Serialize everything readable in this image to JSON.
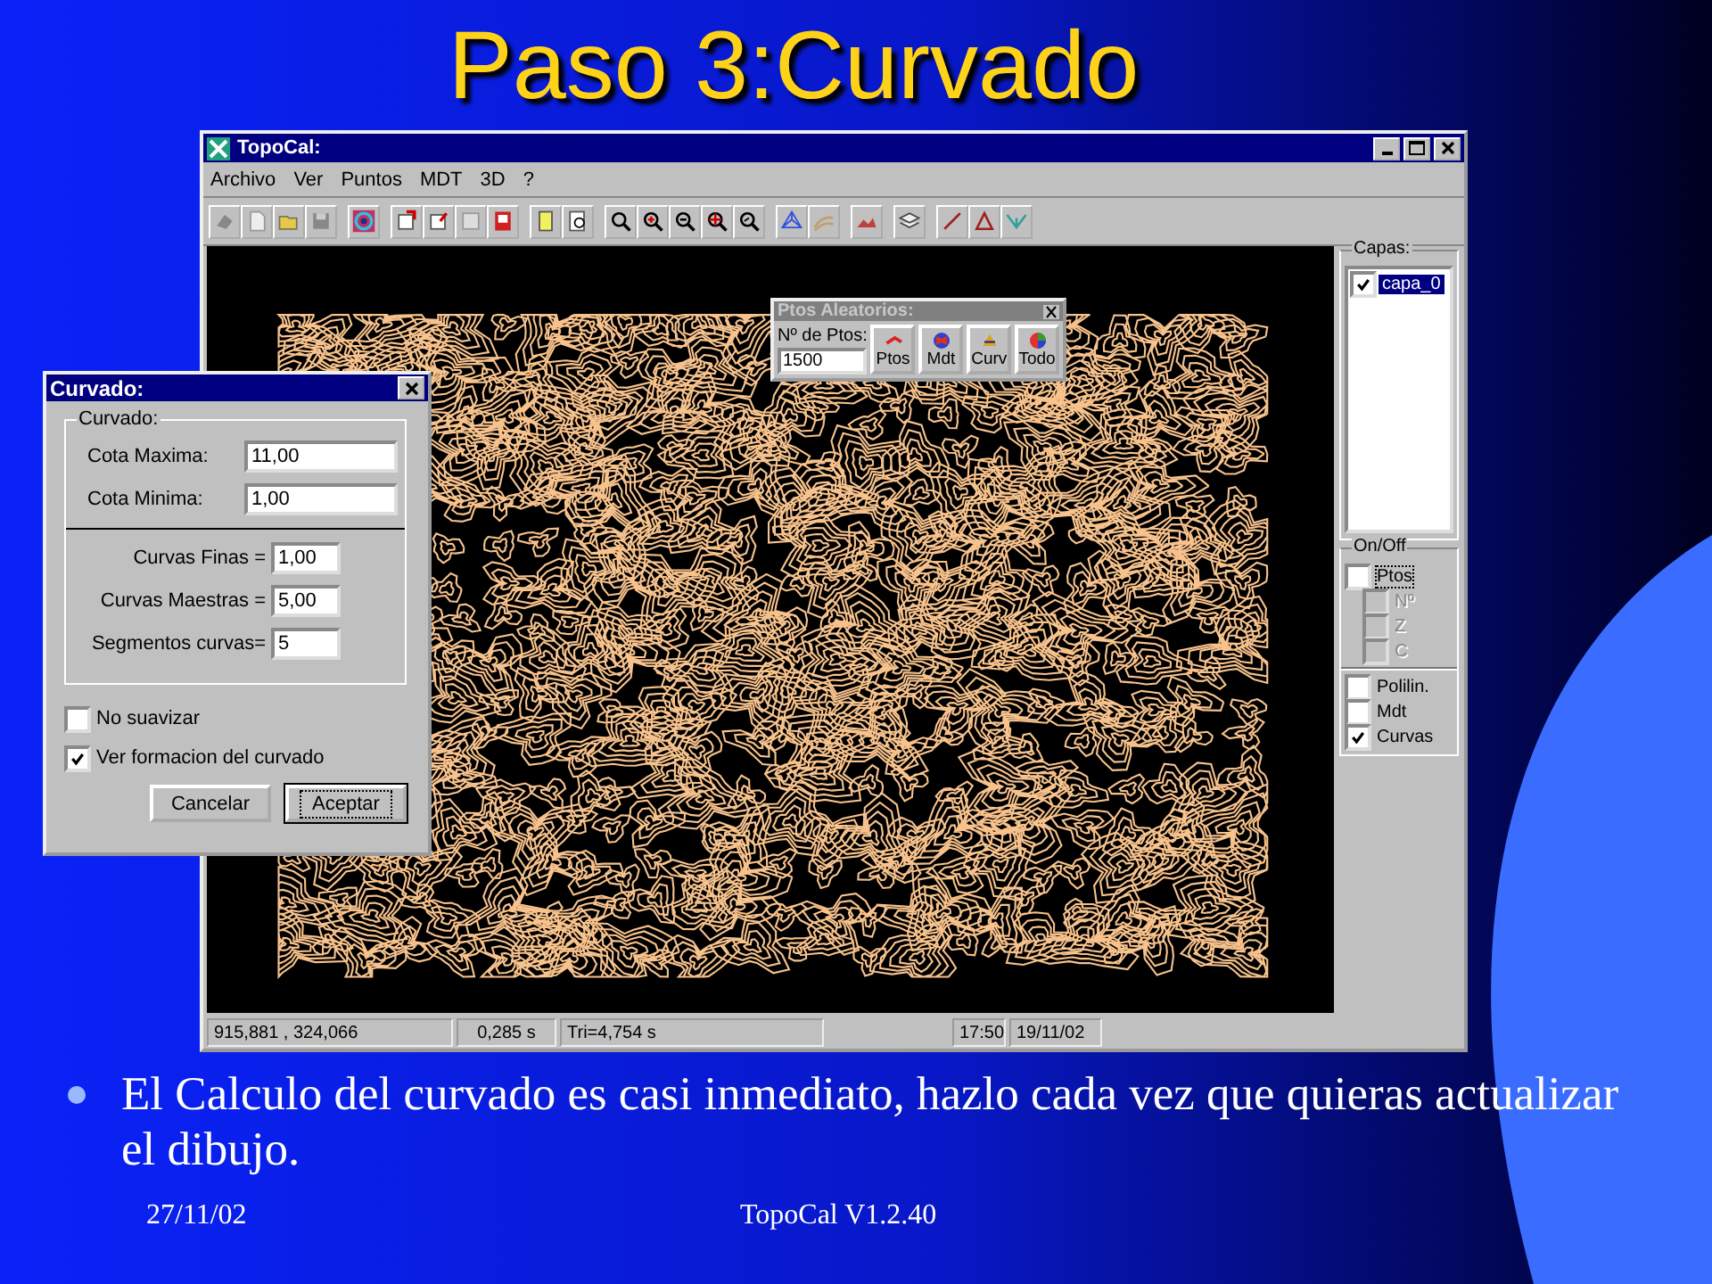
{
  "slide": {
    "title": "Paso 3:Curvado",
    "bullets": [
      "El Calculo del curvado es casi inmediato, hazlo cada vez que quieras actualizar el dibujo."
    ],
    "footer": {
      "date": "27/11/02",
      "center": "TopoCal V1.2.40"
    }
  },
  "window": {
    "title": "TopoCal:",
    "menu": [
      {
        "label": "Archivo"
      },
      {
        "label": "Ver"
      },
      {
        "label": "Puntos"
      },
      {
        "label": "MDT"
      },
      {
        "label": "3D"
      },
      {
        "label": "?"
      }
    ]
  },
  "layers": {
    "title": "Capas:",
    "items": [
      {
        "label": "capa_0",
        "checked": true,
        "selected": true
      }
    ]
  },
  "visibility": {
    "title": "On/Off",
    "items": [
      {
        "label": "Ptos",
        "checked": false,
        "disabled": false,
        "focused": true,
        "children": [
          {
            "label": "Nº",
            "checked": false,
            "disabled": true
          },
          {
            "label": "Z",
            "checked": false,
            "disabled": true
          },
          {
            "label": "C",
            "checked": false,
            "disabled": true
          }
        ]
      }
    ],
    "extra": [
      {
        "label": "Polilin.",
        "checked": false,
        "disabled": false
      },
      {
        "label": "Mdt",
        "checked": false,
        "disabled": false
      },
      {
        "label": "Curvas",
        "checked": true,
        "disabled": false
      }
    ]
  },
  "status_bar": [
    "915,881 , 324,066",
    "0,285 s",
    "Tri=4,754 s",
    "17:50",
    "19/11/02"
  ],
  "random_points_toolbar": {
    "title": "Ptos Aleatorios:",
    "field_label": "Nº de Ptos:",
    "value": "1500",
    "buttons": [
      {
        "label": "Ptos"
      },
      {
        "label": "Mdt"
      },
      {
        "label": "Curv"
      },
      {
        "label": "Todo"
      }
    ]
  },
  "dialog": {
    "title": "Curvado:",
    "group_title": "Curvado:",
    "range_fields": [
      {
        "label": "Cota Maxima:",
        "value": "11,00"
      },
      {
        "label": "Cota Minima:",
        "value": "1,00"
      }
    ],
    "interval_fields": [
      {
        "label": "Curvas Finas =",
        "value": "1,00"
      },
      {
        "label": "Curvas Maestras =",
        "value": "5,00"
      },
      {
        "label": "Segmentos curvas=",
        "value": "5"
      }
    ],
    "options": [
      {
        "label": "No suavizar",
        "checked": false
      },
      {
        "label": "Ver formacion del curvado",
        "checked": true
      }
    ],
    "buttons": [
      {
        "label": "Cancelar",
        "default": false
      },
      {
        "label": "Aceptar",
        "default": true
      }
    ]
  }
}
